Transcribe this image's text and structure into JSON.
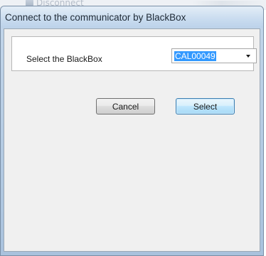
{
  "background_window": {
    "toolbar_item_label": "Disconnect",
    "toolbar_item_icon": "disconnect-icon"
  },
  "dialog": {
    "title": "Connect to the communicator by BlackBox",
    "select_label": "Select the BlackBox",
    "blackbox_combo": {
      "selected_value": "CAL00049",
      "icon": "chevron-down-icon"
    },
    "buttons": {
      "cancel": "Cancel",
      "select": "Select"
    }
  },
  "colors": {
    "selection_highlight": "#3399ff",
    "default_button_border": "#3c7fb1",
    "title_bar": "#c9dcef"
  }
}
